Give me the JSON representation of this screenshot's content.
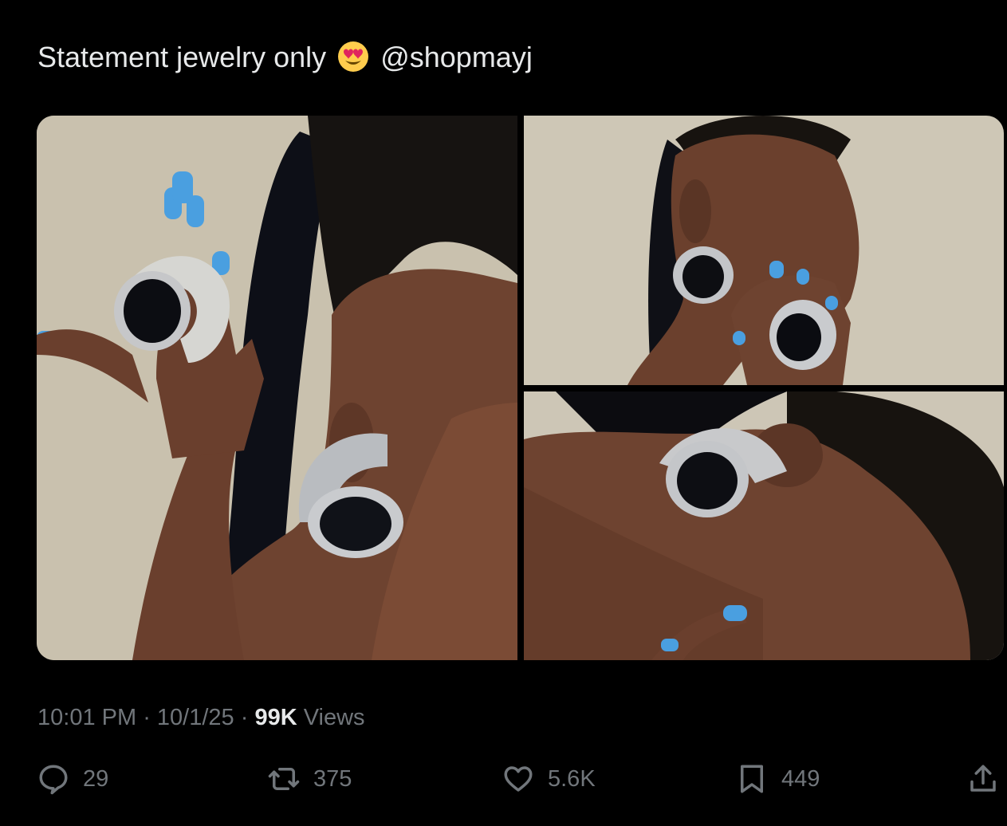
{
  "tweet": {
    "text_before": "Statement jewelry only",
    "emoji": "heart-eyes-emoji",
    "mention": "@shopmayj"
  },
  "media": {
    "photos": [
      {
        "name": "photo-left",
        "description_icon": "portrait-photo"
      },
      {
        "name": "photo-top-right",
        "description_icon": "portrait-photo"
      },
      {
        "name": "photo-bottom-right",
        "description_icon": "portrait-photo"
      }
    ]
  },
  "meta": {
    "time": "10:01 PM",
    "sep1": " · ",
    "date": "10/1/25",
    "sep2": " · ",
    "views_count": "99K",
    "views_label": " Views"
  },
  "actions": {
    "reply_count": "29",
    "retweet_count": "375",
    "like_count": "5.6K",
    "bookmark_count": "449"
  },
  "colors": {
    "background": "#000000",
    "text_primary": "#e7e9ea",
    "text_secondary": "#71767b"
  }
}
